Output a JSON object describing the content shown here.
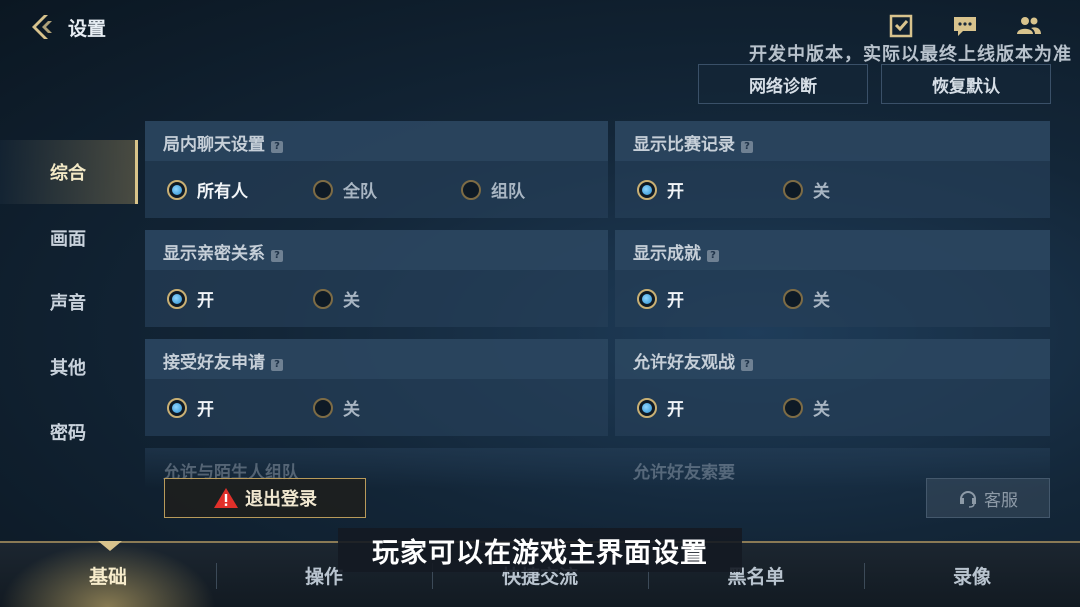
{
  "header": {
    "title": "设置",
    "watermark": "开发中版本，实际以最终上线版本为准",
    "icons": [
      "checklist-icon",
      "chat-icon",
      "friends-icon"
    ],
    "network_button": "网络诊断",
    "reset_button": "恢复默认"
  },
  "sidebar": {
    "items": [
      {
        "label": "综合",
        "active": true
      },
      {
        "label": "画面",
        "active": false
      },
      {
        "label": "声音",
        "active": false
      },
      {
        "label": "其他",
        "active": false
      },
      {
        "label": "密码",
        "active": false
      }
    ]
  },
  "settings": [
    {
      "title": "局内聊天设置",
      "options": [
        "所有人",
        "全队",
        "组队"
      ],
      "selected": 0
    },
    {
      "title": "显示比赛记录",
      "options": [
        "开",
        "关"
      ],
      "selected": 0
    },
    {
      "title": "显示亲密关系",
      "options": [
        "开",
        "关"
      ],
      "selected": 0
    },
    {
      "title": "显示成就",
      "options": [
        "开",
        "关"
      ],
      "selected": 0
    },
    {
      "title": "接受好友申请",
      "options": [
        "开",
        "关"
      ],
      "selected": 0
    },
    {
      "title": "允许好友观战",
      "options": [
        "开",
        "关"
      ],
      "selected": 0
    }
  ],
  "help_mark": "?",
  "partial_rows": [
    "允许与陌生人组队",
    "允许好友索要"
  ],
  "logout_button": "退出登录",
  "service_button": "客服",
  "subtitle": "玩家可以在游戏主界面设置",
  "bottom_tabs": [
    {
      "label": "基础",
      "active": true
    },
    {
      "label": "操作",
      "active": false
    },
    {
      "label": "快捷交流",
      "active": false
    },
    {
      "label": "黑名单",
      "active": false
    },
    {
      "label": "录像",
      "active": false
    }
  ],
  "colors": {
    "accent_gold": "#d9c48a",
    "radio_blue": "#2b8fd0",
    "warning_red": "#e0302a"
  }
}
